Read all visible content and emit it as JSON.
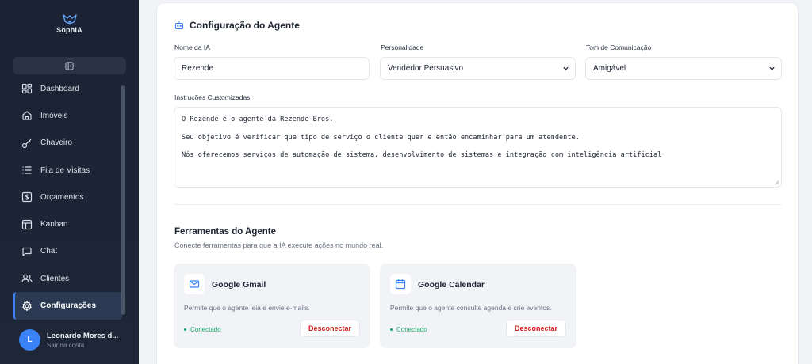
{
  "app": {
    "logo_text": "SophIA"
  },
  "sidebar": {
    "items": [
      {
        "label": "Dashboard",
        "icon": "grid-icon"
      },
      {
        "label": "Imóveis",
        "icon": "home-icon"
      },
      {
        "label": "Chaveiro",
        "icon": "key-icon"
      },
      {
        "label": "Fila de Visitas",
        "icon": "list-icon"
      },
      {
        "label": "Orçamentos",
        "icon": "dollar-icon"
      },
      {
        "label": "Kanban",
        "icon": "kanban-icon"
      },
      {
        "label": "Chat",
        "icon": "chat-icon"
      },
      {
        "label": "Clientes",
        "icon": "users-icon"
      },
      {
        "label": "Configurações",
        "icon": "gear-icon",
        "active": true
      }
    ]
  },
  "user": {
    "initial": "L",
    "name": "Leonardo Mores d...",
    "action": "Sair da conta"
  },
  "agent_config": {
    "title": "Configuração do Agente",
    "name_label": "Nome da IA",
    "name_value": "Rezende",
    "personality_label": "Personalidade",
    "personality_value": "Vendedor Persuasivo",
    "tone_label": "Tom de Comunicação",
    "tone_value": "Amigável",
    "instructions_label": "Instruções Customizadas",
    "instructions_lines": [
      "O Rezende é o agente da Rezende Bros.",
      "Seu objetivo é verificar que tipo de serviço o cliente quer e então encaminhar para um atendente.",
      "Nós oferecemos serviços de automação de sistema, desenvolvimento de sistemas e integração com inteligência artificial"
    ]
  },
  "tools": {
    "title": "Ferramentas do Agente",
    "subtitle": "Conecte ferramentas para que a IA execute ações no mundo real.",
    "items": [
      {
        "name": "Google Gmail",
        "icon": "mail-icon",
        "description": "Permite que o agente leia e envie e-mails.",
        "status": "Conectado",
        "action": "Desconectar"
      },
      {
        "name": "Google Calendar",
        "icon": "calendar-icon",
        "description": "Permite que o agente consulte agenda e crie eventos.",
        "status": "Conectado",
        "action": "Desconectar"
      }
    ]
  },
  "colors": {
    "accent": "#3b82f6",
    "success": "#18a567",
    "danger": "#d21f1f",
    "sidebar_bg": "#1c2536"
  }
}
